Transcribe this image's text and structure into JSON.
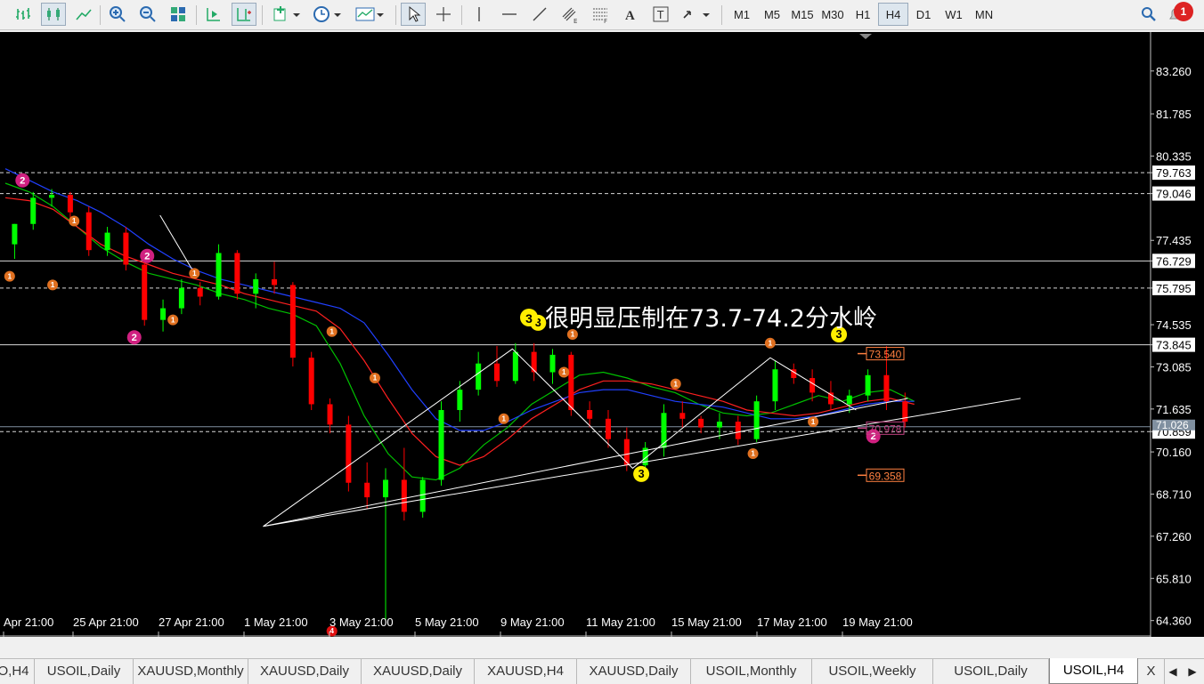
{
  "toolbar": {
    "timeframes": [
      "M1",
      "M5",
      "M15",
      "M30",
      "H1",
      "H4",
      "D1",
      "W1",
      "MN"
    ],
    "active_timeframe": "H4",
    "notification_count": "1",
    "icons": [
      "bar-chart-icon",
      "candlestick-icon",
      "line-chart-icon",
      "zoom-in-icon",
      "zoom-out-icon",
      "tile-windows-icon",
      "auto-scroll-icon",
      "chart-shift-icon",
      "indicators-icon",
      "periods-icon",
      "templates-icon",
      "cursor-icon",
      "crosshair-icon",
      "vertical-line-icon",
      "horizontal-line-icon",
      "trendline-icon",
      "equidistant-channel-icon",
      "fibonacci-icon",
      "text-icon",
      "text-label-icon",
      "arrows-icon",
      "search-icon",
      "notification-icon"
    ]
  },
  "chart": {
    "symbol": "USOIL,H4",
    "colors": {
      "background": "#000000",
      "bull": "#00ff00",
      "bear": "#ff0000",
      "ma_fast": "#00c000",
      "ma_mid": "#ff2020",
      "ma_slow": "#2040ff",
      "grid": "#c0c0c0"
    },
    "annotation": "很明显压制在73.7-74.2分水岭",
    "price_axis": [
      "83.260",
      "81.785",
      "80.335",
      "79.763",
      "79.046",
      "77.435",
      "76.729",
      "75.795",
      "74.535",
      "73.845",
      "73.085",
      "71.635",
      "70.859",
      "70.160",
      "68.710",
      "67.260",
      "65.810",
      "64.360"
    ],
    "highlighted_prices": [
      "79.763",
      "79.046",
      "76.729",
      "75.795",
      "73.845",
      "70.859"
    ],
    "bid_line_price": "71.026",
    "price_labels": [
      "73.540",
      "70.978",
      "69.358"
    ],
    "time_axis": [
      "Apr 21:00",
      "25 Apr 21:00",
      "27 Apr 21:00",
      "1 May 21:00",
      "3 May 21:00",
      "5 May 21:00",
      "9 May 21:00",
      "11 May 21:00",
      "15 May 21:00",
      "17 May 21:00",
      "19 May 21:00"
    ]
  },
  "chart_data": {
    "type": "line",
    "title": "",
    "ylim": [
      63.8,
      84.6
    ],
    "horizontal_levels": [
      {
        "price": 79.763,
        "style": "dashed"
      },
      {
        "price": 79.046,
        "style": "dashed"
      },
      {
        "price": 76.729,
        "style": "solid"
      },
      {
        "price": 75.795,
        "style": "dashed"
      },
      {
        "price": 73.845,
        "style": "solid"
      },
      {
        "price": 70.859,
        "style": "dashed"
      }
    ],
    "series": [
      {
        "values": [
          79.4,
          79.1,
          78.6,
          77.9,
          77.2,
          76.7,
          76.3,
          76.1,
          75.9,
          75.6,
          75.4,
          75.1,
          74.9,
          74.5,
          73.2,
          71.4,
          70.1,
          69.3,
          69.2,
          69.6,
          70.4,
          71.0,
          71.8,
          72.3,
          72.8,
          72.9,
          72.7,
          72.4,
          72.2,
          71.8,
          71.5,
          71.4,
          71.5,
          71.8,
          72.1,
          71.9,
          72.2,
          72.3,
          71.9
        ]
      },
      {
        "values": [
          78.9,
          78.8,
          78.5,
          77.9,
          77.3,
          76.9,
          76.6,
          76.3,
          76.1,
          75.9,
          75.6,
          75.4,
          75.2,
          75.0,
          74.4,
          73.3,
          72.0,
          70.8,
          70.0,
          69.7,
          70.0,
          70.6,
          71.3,
          71.8,
          72.3,
          72.6,
          72.6,
          72.5,
          72.3,
          72.1,
          71.9,
          71.6,
          71.5,
          71.4,
          71.5,
          71.7,
          71.9,
          72.0,
          71.8
        ]
      },
      {
        "values": [
          79.9,
          79.5,
          79.1,
          78.8,
          78.4,
          77.9,
          77.3,
          76.8,
          76.4,
          76.1,
          75.9,
          75.7,
          75.5,
          75.3,
          75.1,
          74.6,
          73.5,
          72.3,
          71.3,
          70.9,
          70.9,
          71.2,
          71.6,
          71.9,
          72.2,
          72.3,
          72.3,
          72.1,
          71.9,
          71.8,
          71.7,
          71.5,
          71.3,
          71.3,
          71.4,
          71.6,
          71.8,
          71.9,
          71.9
        ]
      }
    ],
    "candles": [
      [
        77.3,
        78.0,
        76.8,
        78.0
      ],
      [
        78.0,
        79.1,
        77.8,
        78.9
      ],
      [
        78.9,
        79.2,
        78.6,
        79.0
      ],
      [
        79.0,
        79.1,
        78.2,
        78.4
      ],
      [
        78.4,
        78.6,
        76.9,
        77.1
      ],
      [
        77.1,
        77.9,
        76.9,
        77.7
      ],
      [
        77.7,
        77.9,
        76.4,
        76.6
      ],
      [
        76.6,
        76.9,
        74.5,
        74.7
      ],
      [
        74.7,
        75.4,
        74.3,
        75.1
      ],
      [
        75.1,
        76.1,
        74.9,
        75.8
      ],
      [
        75.8,
        76.0,
        75.2,
        75.5
      ],
      [
        75.5,
        77.3,
        75.4,
        77.0
      ],
      [
        77.0,
        77.1,
        75.4,
        75.6
      ],
      [
        75.6,
        76.3,
        75.1,
        76.1
      ],
      [
        76.1,
        76.7,
        75.6,
        75.9
      ],
      [
        75.9,
        76.0,
        73.1,
        73.4
      ],
      [
        73.4,
        73.6,
        71.6,
        71.8
      ],
      [
        71.8,
        72.0,
        70.8,
        71.1
      ],
      [
        71.1,
        71.4,
        68.8,
        69.1
      ],
      [
        69.1,
        69.8,
        68.2,
        68.6
      ],
      [
        68.6,
        69.6,
        64.4,
        69.2
      ],
      [
        69.2,
        70.3,
        67.8,
        68.1
      ],
      [
        68.1,
        69.3,
        67.9,
        69.2
      ],
      [
        69.2,
        71.9,
        69.0,
        71.6
      ],
      [
        71.6,
        72.6,
        71.2,
        72.3
      ],
      [
        72.3,
        73.6,
        72.1,
        73.2
      ],
      [
        73.2,
        73.8,
        72.4,
        72.6
      ],
      [
        72.6,
        73.9,
        72.5,
        73.6
      ],
      [
        73.6,
        73.9,
        72.6,
        72.9
      ],
      [
        72.9,
        73.7,
        72.5,
        73.5
      ],
      [
        73.5,
        73.6,
        71.4,
        71.6
      ],
      [
        71.6,
        71.9,
        71.0,
        71.3
      ],
      [
        71.3,
        71.6,
        70.3,
        70.6
      ],
      [
        70.6,
        71.0,
        69.5,
        69.7
      ],
      [
        69.7,
        70.5,
        69.5,
        70.3
      ],
      [
        70.3,
        71.8,
        70.0,
        71.5
      ],
      [
        71.5,
        71.9,
        71.0,
        71.3
      ],
      [
        71.3,
        71.4,
        70.8,
        71.0
      ],
      [
        71.0,
        71.5,
        70.6,
        71.2
      ],
      [
        71.2,
        71.4,
        70.4,
        70.6
      ],
      [
        70.6,
        72.1,
        70.5,
        71.9
      ],
      [
        71.9,
        73.3,
        71.6,
        73.0
      ],
      [
        73.0,
        73.2,
        72.5,
        72.7
      ],
      [
        72.7,
        73.0,
        71.9,
        72.2
      ],
      [
        72.2,
        72.6,
        71.6,
        71.8
      ],
      [
        71.8,
        72.3,
        71.5,
        72.1
      ],
      [
        72.1,
        73.0,
        71.9,
        72.8
      ],
      [
        72.8,
        73.8,
        71.6,
        71.9
      ],
      [
        71.9,
        72.2,
        71.0,
        71.2
      ]
    ],
    "wave_lines": [
      {
        "points": [
          [
            3,
            67.6
          ],
          [
            5.9,
            73.7
          ],
          [
            7.3,
            69.6
          ],
          [
            8.9,
            73.4
          ],
          [
            9.9,
            71.6
          ]
        ]
      },
      {
        "points": [
          [
            3,
            67.6
          ],
          [
            10.5,
            72.0
          ]
        ]
      },
      {
        "points": [
          [
            1.8,
            78.3
          ],
          [
            2.2,
            76.3
          ]
        ]
      }
    ],
    "markers": [
      {
        "label": "1",
        "x": 0.05,
        "price": 76.2
      },
      {
        "label": "1",
        "x": 0.55,
        "price": 75.9
      },
      {
        "label": "1",
        "x": 0.8,
        "price": 78.1
      },
      {
        "label": "2",
        "x": 0.2,
        "price": 79.5
      },
      {
        "label": "2",
        "x": 1.65,
        "price": 76.9
      },
      {
        "label": "2",
        "x": 1.5,
        "price": 74.1
      },
      {
        "label": "1",
        "x": 2.2,
        "price": 76.3
      },
      {
        "label": "1",
        "x": 1.95,
        "price": 74.7
      },
      {
        "label": "1",
        "x": 3.8,
        "price": 74.3
      },
      {
        "label": "1",
        "x": 4.3,
        "price": 72.7
      },
      {
        "label": "1",
        "x": 6.6,
        "price": 74.2
      },
      {
        "label": "1",
        "x": 5.8,
        "price": 71.3
      },
      {
        "label": "1",
        "x": 6.5,
        "price": 72.9
      },
      {
        "label": "3",
        "x": 6.2,
        "price": 74.6
      },
      {
        "label": "1",
        "x": 7.8,
        "price": 72.5
      },
      {
        "label": "3",
        "x": 7.4,
        "price": 69.4
      },
      {
        "label": "1",
        "x": 8.9,
        "price": 73.9
      },
      {
        "label": "1",
        "x": 8.7,
        "price": 70.1
      },
      {
        "label": "1",
        "x": 9.4,
        "price": 71.2
      },
      {
        "label": "3",
        "x": 9.7,
        "price": 74.2
      },
      {
        "label": "2",
        "x": 10.1,
        "price": 70.7
      },
      {
        "label": "4",
        "x": 3.8,
        "price": 64.0
      }
    ]
  },
  "tabs": {
    "items": [
      {
        "label": "O,H4",
        "active": false
      },
      {
        "label": "USOIL,Daily",
        "active": false
      },
      {
        "label": "XAUUSD,Monthly",
        "active": false
      },
      {
        "label": "XAUUSD,Daily",
        "active": false
      },
      {
        "label": "XAUUSD,Daily",
        "active": false
      },
      {
        "label": "XAUUSD,H4",
        "active": false
      },
      {
        "label": "XAUUSD,Daily",
        "active": false
      },
      {
        "label": "USOIL,Monthly",
        "active": false
      },
      {
        "label": "USOIL,Weekly",
        "active": false
      },
      {
        "label": "USOIL,Daily",
        "active": false
      },
      {
        "label": "USOIL,H4",
        "active": true
      },
      {
        "label": "X",
        "active": false
      }
    ],
    "prev_label": "◀",
    "next_label": "▶"
  }
}
